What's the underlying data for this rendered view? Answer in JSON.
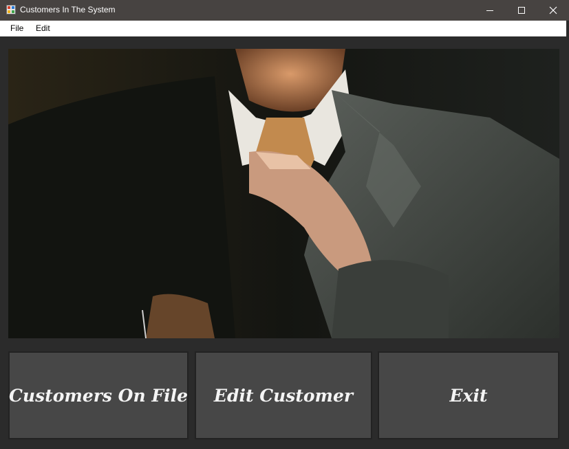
{
  "window": {
    "title": "Customers In The System",
    "icon": "form-app-icon",
    "controls": [
      "minimize-icon",
      "maximize-icon",
      "close-icon"
    ]
  },
  "menu": {
    "items": [
      {
        "label": "File"
      },
      {
        "label": "Edit"
      }
    ]
  },
  "hero_image": {
    "description_icon": "businessman-adjusting-tie-photo"
  },
  "buttons": {
    "customers_on_file": "Customers On File",
    "edit_customer": "Edit Customer",
    "exit": "Exit"
  },
  "colors": {
    "title_bar": "#474341",
    "background": "#2b2b2b",
    "button": "#474747",
    "button_text": "#f4f4f4"
  }
}
